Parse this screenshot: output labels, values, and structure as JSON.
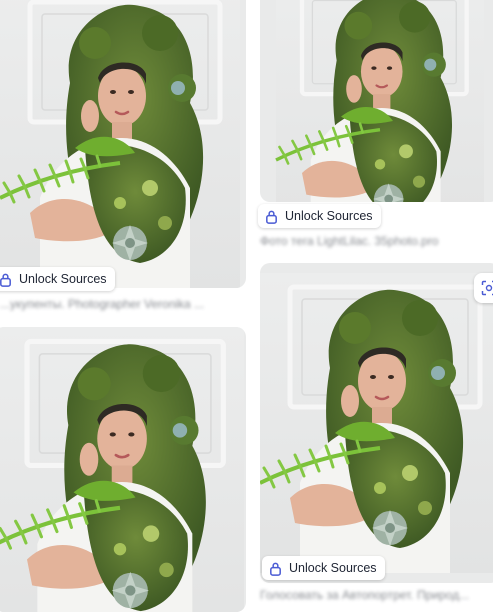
{
  "colors": {
    "badge_bg": "#ffffff",
    "badge_text": "#1e2433",
    "lock_icon": "#4a5bd4",
    "caption": "#6b6f76"
  },
  "cards": [
    {
      "unlock_label": "Unlock Sources",
      "caption": "...укупенты. Photographer Veronika ..."
    },
    {
      "unlock_label": "Unlock Sources",
      "caption": "Фото тега LightLilac. 35photo.pro"
    },
    {
      "unlock_label": "",
      "caption": ""
    },
    {
      "unlock_label": "Unlock Sources",
      "caption": "Голосовать за Автопортрет. Природ..."
    }
  ],
  "icons": {
    "lock": "lock-icon",
    "scan": "image-scan-icon"
  }
}
